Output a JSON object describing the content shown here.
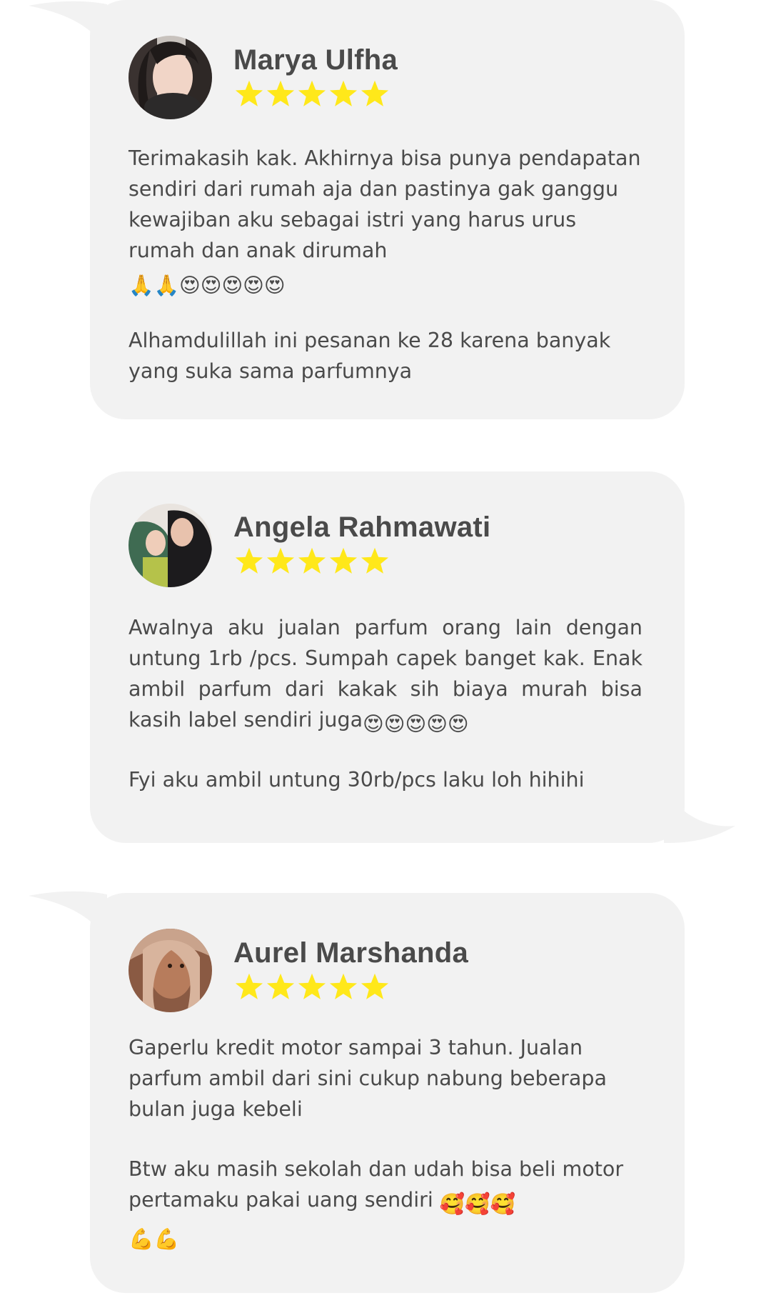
{
  "colors": {
    "bubble": "#f2f2f2",
    "text": "#4a4a4a",
    "star": "#ffe81a",
    "page_background": "#ffffff"
  },
  "reviews": [
    {
      "name": "Marya Ulfha",
      "rating": 5,
      "paragraphs": [
        "Terimakasih kak. Akhirnya bisa punya pendapatan sendiri dari rumah aja dan pastinya gak ganggu kewajiban aku sebagai istri yang harus urus rumah dan anak dirumah",
        "Alhamdulillah ini pesanan ke 28 karena banyak yang suka sama parfumnya"
      ],
      "emojis": [
        "🙏",
        "🙏",
        "😍",
        "😍",
        "😍",
        "😍",
        "😍"
      ]
    },
    {
      "name": "Angela Rahmawati",
      "rating": 5,
      "paragraphs": [
        "Awalnya aku jualan parfum orang lain dengan untung 1rb /pcs. Sumpah capek banget kak. Enak ambil parfum dari kakak sih biaya murah bisa kasih label sendiri juga",
        "Fyi aku ambil untung 30rb/pcs laku loh hihihi"
      ],
      "emojis": [
        "😍",
        "😍",
        "😍",
        "😍",
        "😍"
      ]
    },
    {
      "name": "Aurel Marshanda",
      "rating": 5,
      "paragraphs": [
        "Gaperlu kredit motor sampai 3 tahun. Jualan parfum ambil dari sini cukup nabung beberapa bulan juga kebeli",
        "Btw aku masih sekolah dan udah bisa beli motor pertamaku pakai uang sendiri"
      ],
      "emojis": [
        "🥰",
        "🥰",
        "🥰",
        "💪",
        "💪"
      ]
    }
  ]
}
